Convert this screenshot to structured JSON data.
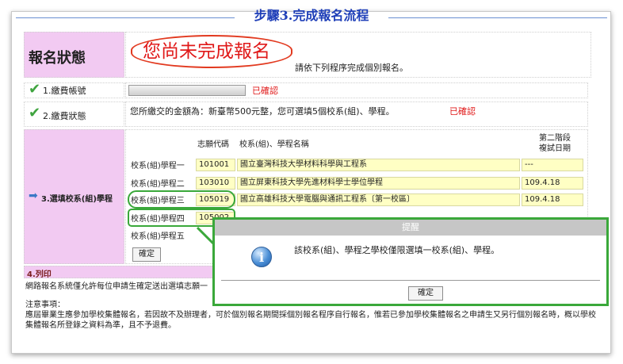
{
  "step_title": "步驟3.完成報名流程",
  "status": {
    "label": "報名狀態",
    "not_complete": "您尚未完成報名",
    "instruction": "請依下列程序完成個別報名。"
  },
  "rows": {
    "fee_account": {
      "label": "1.繳費帳號",
      "status": "已確認"
    },
    "fee_status": {
      "label": "2.繳費狀態",
      "text": "您所繳交的金額為：新臺幣500元整，您可選填5個校系(組)、學程。",
      "status": "已確認"
    }
  },
  "choices": {
    "section_label": "3.選填校系(組)學程",
    "headers": {
      "code": "志願代碼",
      "name": "校系(組)、學程名稱",
      "stage2": "第二階段\n複試日期"
    },
    "items": [
      {
        "label": "校系(組)學程一",
        "code": "101001",
        "name": "國立臺灣科技大學材料科學與工程系",
        "date": "---"
      },
      {
        "label": "校系(組)學程二",
        "code": "103010",
        "name": "國立屏東科技大學先進材料學士學位學程",
        "date": "109.4.18"
      },
      {
        "label": "校系(組)學程三",
        "code": "105019",
        "name": "國立高雄科技大學電腦與通訊工程系〔第一校區〕",
        "date": "109.4.18"
      },
      {
        "label": "校系(組)學程四",
        "code": "105002",
        "name": "",
        "date": ""
      },
      {
        "label": "校系(組)學程五",
        "code": "",
        "name": "",
        "date": ""
      }
    ],
    "confirm_button": "確定"
  },
  "print_section": {
    "label": "4.列印",
    "text": "網路報名系統僅允許每位申請生確定送出選填志願一"
  },
  "notes": {
    "title": "注意事項：",
    "body": "應屆畢業生應參加學校集體報名，若因故不及辦理者，可於個別報名期間採個別報名程序自行報名，惟若已參加學校集體報名之申請生又另行個別報名時，概以學校集體報名所登錄之資料為準，且不予退費。"
  },
  "dialog": {
    "title": "提醒",
    "icon": "info-icon",
    "message": "該校系(組)、學程之學校僅限選填一校系(組)、學程。",
    "ok_button": "確定"
  },
  "colors": {
    "accent_pink": "#f2caf2",
    "input_yellow": "#ffffc4",
    "highlight_green": "#3aa83a",
    "alert_red": "#e01919",
    "title_blue": "#1f3fb8"
  }
}
